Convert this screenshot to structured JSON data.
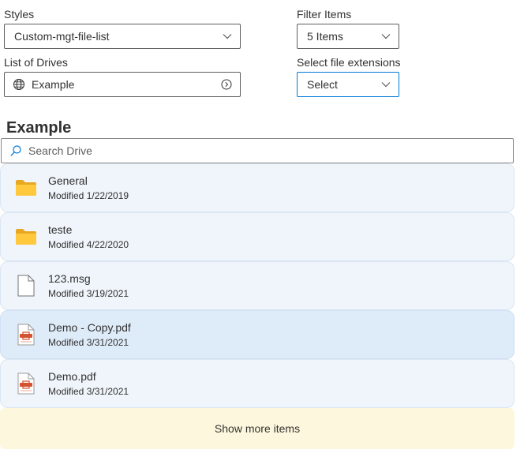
{
  "styles": {
    "label": "Styles",
    "value": "Custom-mgt-file-list"
  },
  "filter_items": {
    "label": "Filter Items",
    "value": "5 Items"
  },
  "drives": {
    "label": "List of Drives",
    "value": "Example"
  },
  "extensions": {
    "label": "Select file extensions",
    "value": "Select"
  },
  "drive_title": "Example",
  "search": {
    "placeholder": "Search Drive"
  },
  "files": [
    {
      "name": "General",
      "modified": "Modified 1/22/2019",
      "icon": "folder-icon"
    },
    {
      "name": "teste",
      "modified": "Modified 4/22/2020",
      "icon": "folder-icon"
    },
    {
      "name": "123.msg",
      "modified": "Modified 3/19/2021",
      "icon": "generic-file-icon"
    },
    {
      "name": "Demo - Copy.pdf",
      "modified": "Modified 3/31/2021",
      "icon": "pdf-file-icon",
      "selected": true
    },
    {
      "name": "Demo.pdf",
      "modified": "Modified 3/31/2021",
      "icon": "pdf-file-icon"
    }
  ],
  "show_more_label": "Show more items",
  "colors": {
    "accent": "#0078d4",
    "item_bg": "#eff5fb",
    "item_selected_bg": "#deebf8",
    "show_more_bg": "#fdf8dd",
    "folder": "#ffc83d"
  }
}
